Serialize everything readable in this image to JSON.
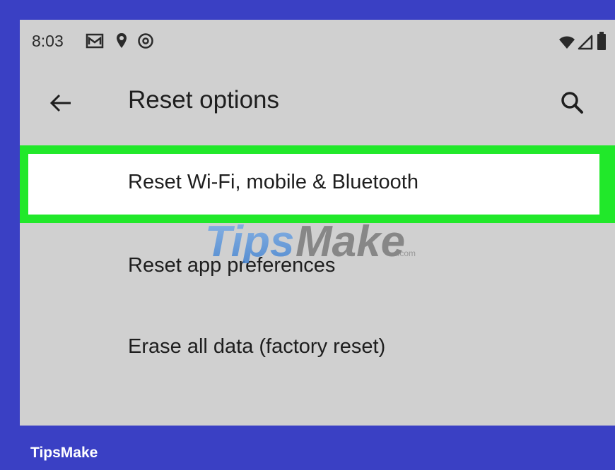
{
  "status_bar": {
    "time": "8:03",
    "left_icons": [
      "gmail-icon",
      "location-pin-icon",
      "data-saver-icon"
    ],
    "right_icons": [
      "wifi-icon",
      "cellular-signal-icon",
      "battery-icon"
    ]
  },
  "app_bar": {
    "back_icon": "back-arrow-icon",
    "title": "Reset options",
    "search_icon": "search-icon"
  },
  "options": [
    {
      "label": "Reset Wi-Fi, mobile & Bluetooth",
      "highlighted": true
    },
    {
      "label": "Reset app preferences",
      "highlighted": false
    },
    {
      "label": "Erase all data (factory reset)",
      "highlighted": false
    }
  ],
  "watermark": {
    "text_tips": "Tips",
    "text_make": "Make",
    "text_com": ".com"
  },
  "footer": {
    "brand": "TipsMake"
  },
  "colors": {
    "frame": "#3a40c4",
    "screen_bg": "#d0d0d0",
    "highlight_border": "#21e82a"
  }
}
